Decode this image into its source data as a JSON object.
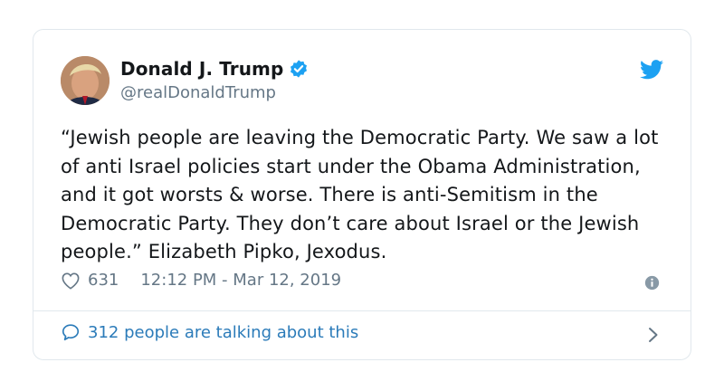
{
  "tweet": {
    "author_name": "Donald J. Trump",
    "handle": "@realDonaldTrump",
    "verified": true,
    "text": "“Jewish people are leaving the Democratic Party. We saw a lot of anti Israel policies start under the Obama Administration, and it got worsts & worse. There is anti-Semitism in the Democratic Party. They don’t care about Israel or the Jewish people.” Elizabeth Pipko, Jexodus.",
    "likes": "631",
    "timestamp": "12:12 PM - Mar 12, 2019",
    "talking": "312 people are talking about this"
  },
  "icons": {
    "avatar": "author-avatar",
    "verified": "verified-badge-icon",
    "brand": "twitter-bird-icon",
    "like": "heart-icon",
    "info": "info-icon",
    "reply": "speech-bubble-icon",
    "chevron": "chevron-right-icon"
  },
  "colors": {
    "accent": "#1da1f2",
    "link": "#2b7bb9",
    "muted": "#657786",
    "border": "#e1e8ed"
  }
}
